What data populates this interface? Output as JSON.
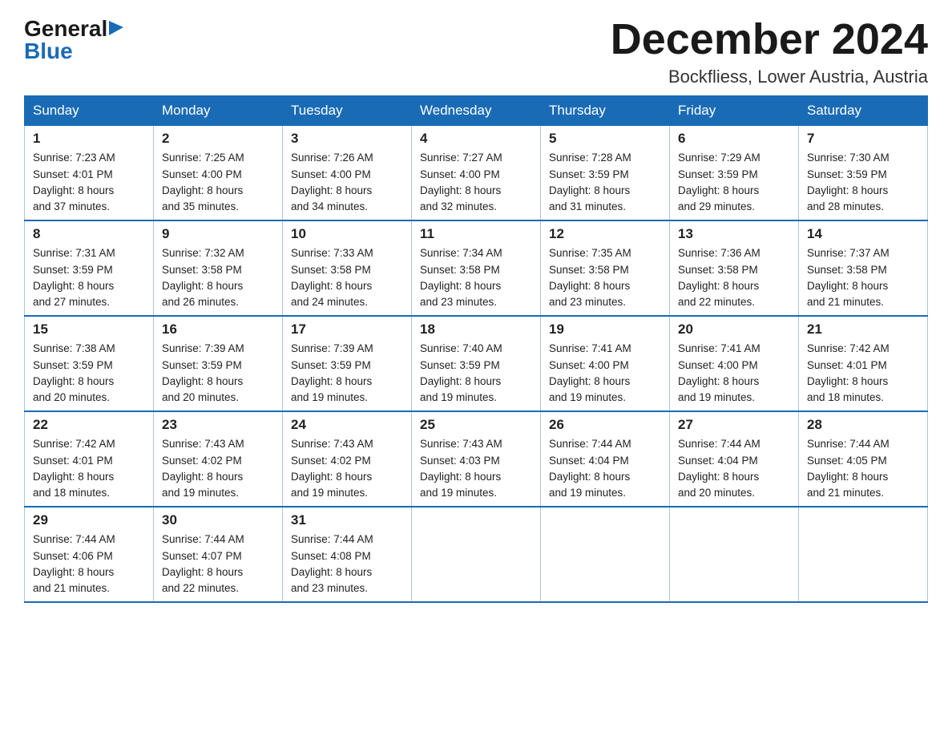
{
  "header": {
    "logo_general": "General",
    "logo_blue": "Blue",
    "month_title": "December 2024",
    "location": "Bockfliess, Lower Austria, Austria"
  },
  "days_of_week": [
    "Sunday",
    "Monday",
    "Tuesday",
    "Wednesday",
    "Thursday",
    "Friday",
    "Saturday"
  ],
  "weeks": [
    [
      {
        "day": "1",
        "sunrise": "7:23 AM",
        "sunset": "4:01 PM",
        "daylight": "8 hours and 37 minutes."
      },
      {
        "day": "2",
        "sunrise": "7:25 AM",
        "sunset": "4:00 PM",
        "daylight": "8 hours and 35 minutes."
      },
      {
        "day": "3",
        "sunrise": "7:26 AM",
        "sunset": "4:00 PM",
        "daylight": "8 hours and 34 minutes."
      },
      {
        "day": "4",
        "sunrise": "7:27 AM",
        "sunset": "4:00 PM",
        "daylight": "8 hours and 32 minutes."
      },
      {
        "day": "5",
        "sunrise": "7:28 AM",
        "sunset": "3:59 PM",
        "daylight": "8 hours and 31 minutes."
      },
      {
        "day": "6",
        "sunrise": "7:29 AM",
        "sunset": "3:59 PM",
        "daylight": "8 hours and 29 minutes."
      },
      {
        "day": "7",
        "sunrise": "7:30 AM",
        "sunset": "3:59 PM",
        "daylight": "8 hours and 28 minutes."
      }
    ],
    [
      {
        "day": "8",
        "sunrise": "7:31 AM",
        "sunset": "3:59 PM",
        "daylight": "8 hours and 27 minutes."
      },
      {
        "day": "9",
        "sunrise": "7:32 AM",
        "sunset": "3:58 PM",
        "daylight": "8 hours and 26 minutes."
      },
      {
        "day": "10",
        "sunrise": "7:33 AM",
        "sunset": "3:58 PM",
        "daylight": "8 hours and 24 minutes."
      },
      {
        "day": "11",
        "sunrise": "7:34 AM",
        "sunset": "3:58 PM",
        "daylight": "8 hours and 23 minutes."
      },
      {
        "day": "12",
        "sunrise": "7:35 AM",
        "sunset": "3:58 PM",
        "daylight": "8 hours and 23 minutes."
      },
      {
        "day": "13",
        "sunrise": "7:36 AM",
        "sunset": "3:58 PM",
        "daylight": "8 hours and 22 minutes."
      },
      {
        "day": "14",
        "sunrise": "7:37 AM",
        "sunset": "3:58 PM",
        "daylight": "8 hours and 21 minutes."
      }
    ],
    [
      {
        "day": "15",
        "sunrise": "7:38 AM",
        "sunset": "3:59 PM",
        "daylight": "8 hours and 20 minutes."
      },
      {
        "day": "16",
        "sunrise": "7:39 AM",
        "sunset": "3:59 PM",
        "daylight": "8 hours and 20 minutes."
      },
      {
        "day": "17",
        "sunrise": "7:39 AM",
        "sunset": "3:59 PM",
        "daylight": "8 hours and 19 minutes."
      },
      {
        "day": "18",
        "sunrise": "7:40 AM",
        "sunset": "3:59 PM",
        "daylight": "8 hours and 19 minutes."
      },
      {
        "day": "19",
        "sunrise": "7:41 AM",
        "sunset": "4:00 PM",
        "daylight": "8 hours and 19 minutes."
      },
      {
        "day": "20",
        "sunrise": "7:41 AM",
        "sunset": "4:00 PM",
        "daylight": "8 hours and 19 minutes."
      },
      {
        "day": "21",
        "sunrise": "7:42 AM",
        "sunset": "4:01 PM",
        "daylight": "8 hours and 18 minutes."
      }
    ],
    [
      {
        "day": "22",
        "sunrise": "7:42 AM",
        "sunset": "4:01 PM",
        "daylight": "8 hours and 18 minutes."
      },
      {
        "day": "23",
        "sunrise": "7:43 AM",
        "sunset": "4:02 PM",
        "daylight": "8 hours and 19 minutes."
      },
      {
        "day": "24",
        "sunrise": "7:43 AM",
        "sunset": "4:02 PM",
        "daylight": "8 hours and 19 minutes."
      },
      {
        "day": "25",
        "sunrise": "7:43 AM",
        "sunset": "4:03 PM",
        "daylight": "8 hours and 19 minutes."
      },
      {
        "day": "26",
        "sunrise": "7:44 AM",
        "sunset": "4:04 PM",
        "daylight": "8 hours and 19 minutes."
      },
      {
        "day": "27",
        "sunrise": "7:44 AM",
        "sunset": "4:04 PM",
        "daylight": "8 hours and 20 minutes."
      },
      {
        "day": "28",
        "sunrise": "7:44 AM",
        "sunset": "4:05 PM",
        "daylight": "8 hours and 21 minutes."
      }
    ],
    [
      {
        "day": "29",
        "sunrise": "7:44 AM",
        "sunset": "4:06 PM",
        "daylight": "8 hours and 21 minutes."
      },
      {
        "day": "30",
        "sunrise": "7:44 AM",
        "sunset": "4:07 PM",
        "daylight": "8 hours and 22 minutes."
      },
      {
        "day": "31",
        "sunrise": "7:44 AM",
        "sunset": "4:08 PM",
        "daylight": "8 hours and 23 minutes."
      },
      null,
      null,
      null,
      null
    ]
  ],
  "labels": {
    "sunrise": "Sunrise:",
    "sunset": "Sunset:",
    "daylight": "Daylight:"
  }
}
